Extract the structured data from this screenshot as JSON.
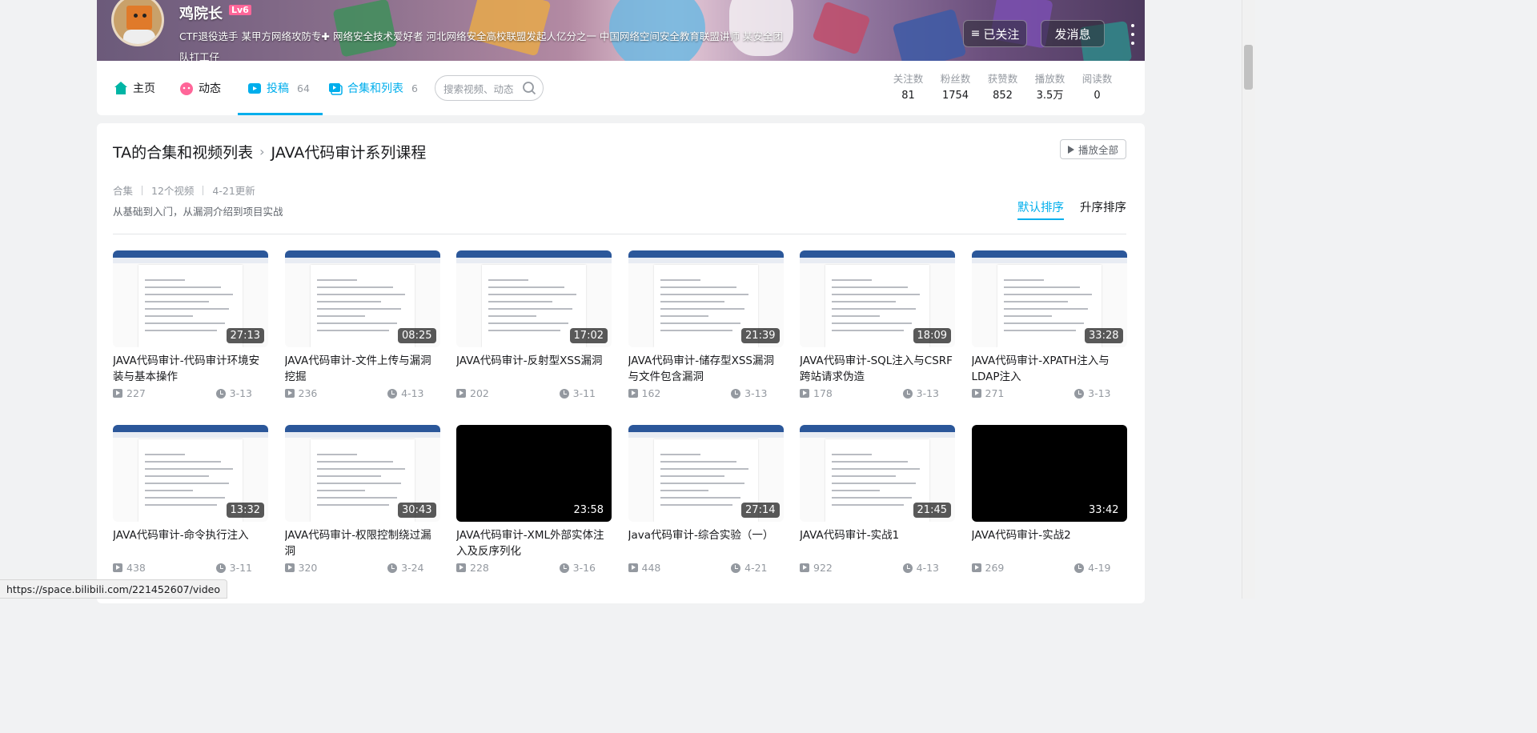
{
  "header": {
    "username": "鸡院长",
    "level": "Lv6",
    "signature": "CTF退役选手 某甲方网络攻防专✚ 网络安全技术爱好者 河北网络安全高校联盟发起人亿分之一 中国网络空间安全教育联盟讲师 某安全团队打工仔",
    "follow_button": "已关注",
    "message_button": "发消息"
  },
  "nav": {
    "items": [
      {
        "label": "主页",
        "count": ""
      },
      {
        "label": "动态",
        "count": ""
      },
      {
        "label": "投稿",
        "count": "64"
      },
      {
        "label": "合集和列表",
        "count": "6"
      }
    ],
    "search_placeholder": "搜索视频、动态"
  },
  "stats": [
    {
      "label": "关注数",
      "value": "81"
    },
    {
      "label": "粉丝数",
      "value": "1754"
    },
    {
      "label": "获赞数",
      "value": "852"
    },
    {
      "label": "播放数",
      "value": "3.5万"
    },
    {
      "label": "阅读数",
      "value": "0"
    }
  ],
  "collection": {
    "breadcrumb_root": "TA的合集和视频列表",
    "breadcrumb_current": "JAVA代码审计系列课程",
    "play_all": "播放全部",
    "type": "合集",
    "video_count": "12个视频",
    "updated": "4-21更新",
    "description": "从基础到入门，从漏洞介绍到项目实战",
    "sort_default": "默认排序",
    "sort_asc": "升序排序"
  },
  "videos": [
    {
      "title": "JAVA代码审计-代码审计环境安装与基本操作",
      "duration": "27:13",
      "plays": "227",
      "date": "3-13",
      "thumb": "doc"
    },
    {
      "title": "JAVA代码审计-文件上传与漏洞挖掘",
      "duration": "08:25",
      "plays": "236",
      "date": "4-13",
      "thumb": "doc"
    },
    {
      "title": "JAVA代码审计-反射型XSS漏洞",
      "duration": "17:02",
      "plays": "202",
      "date": "3-11",
      "thumb": "doc"
    },
    {
      "title": "JAVA代码审计-储存型XSS漏洞与文件包含漏洞",
      "duration": "21:39",
      "plays": "162",
      "date": "3-13",
      "thumb": "doc"
    },
    {
      "title": "JAVA代码审计-SQL注入与CSRF跨站请求伪造",
      "duration": "18:09",
      "plays": "178",
      "date": "3-13",
      "thumb": "doc"
    },
    {
      "title": "JAVA代码审计-XPATH注入与LDAP注入",
      "duration": "33:28",
      "plays": "271",
      "date": "3-13",
      "thumb": "doc"
    },
    {
      "title": "JAVA代码审计-命令执行注入",
      "duration": "13:32",
      "plays": "438",
      "date": "3-11",
      "thumb": "doc"
    },
    {
      "title": "JAVA代码审计-权限控制绕过漏洞",
      "duration": "30:43",
      "plays": "320",
      "date": "3-24",
      "thumb": "doc"
    },
    {
      "title": "JAVA代码审计-XML外部实体注入及反序列化",
      "duration": "23:58",
      "plays": "228",
      "date": "3-16",
      "thumb": "dark"
    },
    {
      "title": "Java代码审计-综合实验（一）",
      "duration": "27:14",
      "plays": "448",
      "date": "4-21",
      "thumb": "doc"
    },
    {
      "title": "JAVA代码审计-实战1",
      "duration": "21:45",
      "plays": "922",
      "date": "4-13",
      "thumb": "doc"
    },
    {
      "title": "JAVA代码审计-实战2",
      "duration": "33:42",
      "plays": "269",
      "date": "4-19",
      "thumb": "dark"
    }
  ],
  "status_url": "https://space.bilibili.com/221452607/video",
  "colors": {
    "accent": "#00aeec",
    "text": "#18191c",
    "muted": "#9499a0"
  }
}
